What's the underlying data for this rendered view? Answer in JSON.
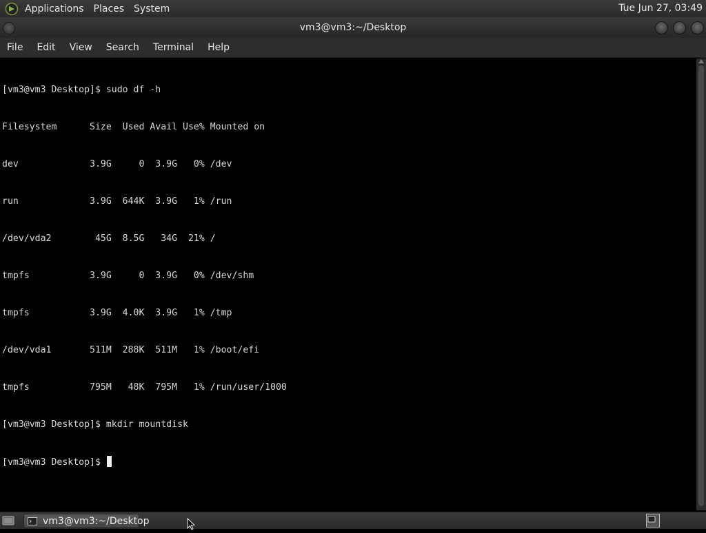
{
  "top_panel": {
    "menus": [
      "Applications",
      "Places",
      "System"
    ],
    "clock": "Tue Jun 27, 03:49"
  },
  "window": {
    "title": "vm3@vm3:~/Desktop",
    "menu": [
      "File",
      "Edit",
      "View",
      "Search",
      "Terminal",
      "Help"
    ]
  },
  "terminal": {
    "lines": [
      "[vm3@vm3 Desktop]$ sudo df -h",
      "Filesystem      Size  Used Avail Use% Mounted on",
      "dev             3.9G     0  3.9G   0% /dev",
      "run             3.9G  644K  3.9G   1% /run",
      "/dev/vda2        45G  8.5G   34G  21% /",
      "tmpfs           3.9G     0  3.9G   0% /dev/shm",
      "tmpfs           3.9G  4.0K  3.9G   1% /tmp",
      "/dev/vda1       511M  288K  511M   1% /boot/efi",
      "tmpfs           795M   48K  795M   1% /run/user/1000",
      "[vm3@vm3 Desktop]$ mkdir mountdisk"
    ],
    "prompt": "[vm3@vm3 Desktop]$ "
  },
  "taskbar": {
    "task_label": "vm3@vm3:~/Desktop"
  },
  "icons": {
    "logo": "mate-logo-icon",
    "window_menu": "window-menu-icon",
    "minimize": "minimize-icon",
    "maximize": "maximize-icon",
    "close": "close-icon",
    "show_desktop": "show-desktop-icon",
    "terminal": "terminal-icon",
    "workspace": "workspace-switcher-icon",
    "mouse": "mouse-pointer-icon"
  }
}
